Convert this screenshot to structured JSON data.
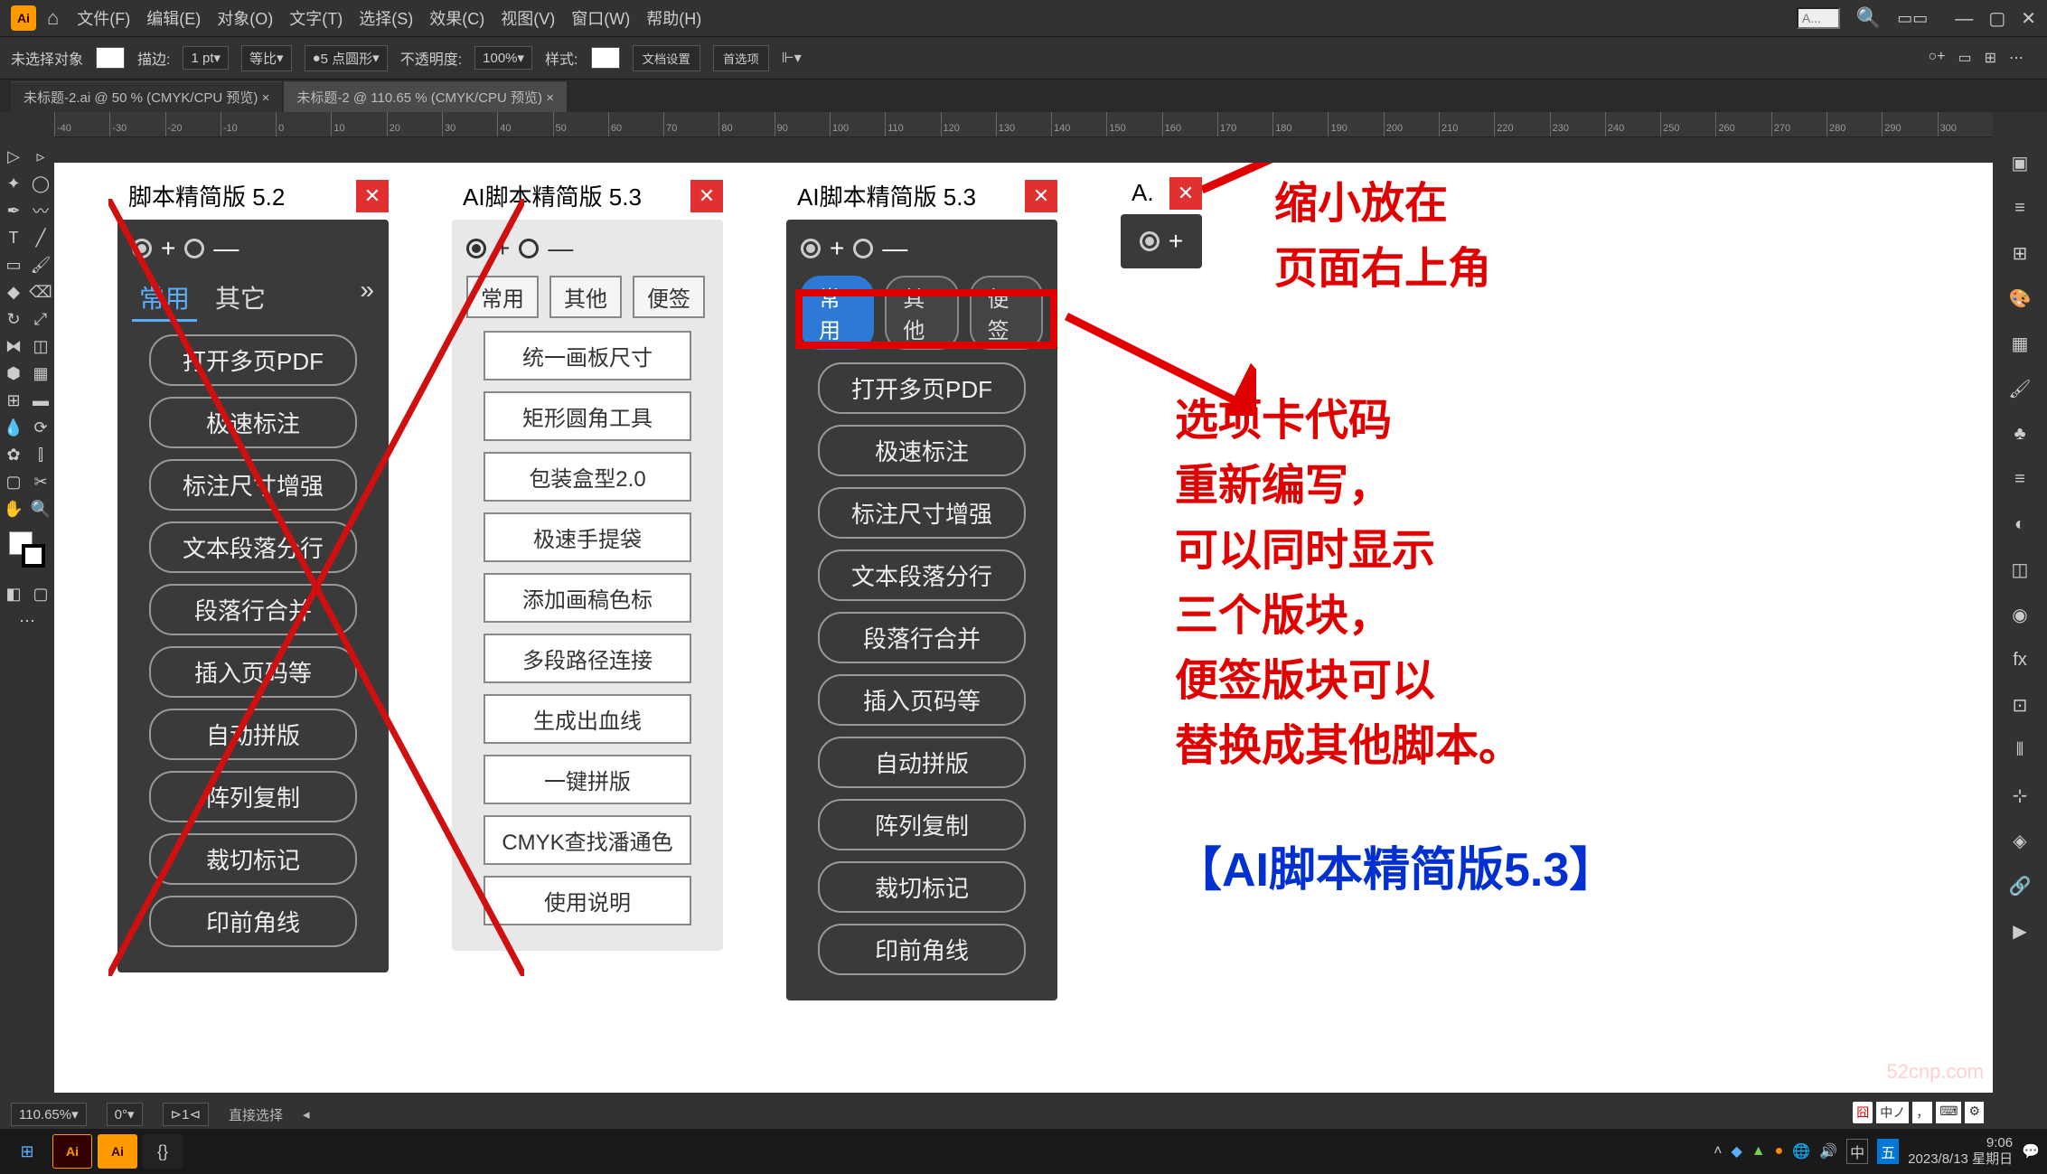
{
  "menu": {
    "items": [
      "文件(F)",
      "编辑(E)",
      "对象(O)",
      "文字(T)",
      "选择(S)",
      "效果(C)",
      "视图(V)",
      "窗口(W)",
      "帮助(H)"
    ],
    "topInputPlaceholder": "A..."
  },
  "optionsBar": {
    "noSelection": "未选择对象",
    "stroke": "描边:",
    "strokeVal": "1 pt",
    "uniform": "等比",
    "brushVal": "5 点圆形",
    "opacity": "不透明度:",
    "opacityVal": "100%",
    "style": "样式:",
    "docSetup": "文档设置",
    "prefs": "首选项"
  },
  "tabs": {
    "tab1": "未标题-2.ai @ 50 % (CMYK/CPU 预览)",
    "tab2": "未标题-2 @ 110.65 % (CMYK/CPU 预览)"
  },
  "ruler": [
    "-40",
    "-30",
    "-20",
    "-10",
    "0",
    "10",
    "20",
    "30",
    "40",
    "50",
    "60",
    "70",
    "80",
    "90",
    "100",
    "110",
    "120",
    "130",
    "140",
    "150",
    "160",
    "170",
    "180",
    "190",
    "200",
    "210",
    "220",
    "230",
    "240",
    "250",
    "260",
    "270",
    "280",
    "290",
    "300"
  ],
  "panel52": {
    "title": "脚本精简版 5.2",
    "tabs": [
      "常用",
      "其它"
    ],
    "buttons": [
      "打开多页PDF",
      "极速标注",
      "标注尺寸增强",
      "文本段落分行",
      "段落行合并",
      "插入页码等",
      "自动拼版",
      "阵列复制",
      "裁切标记",
      "印前角线"
    ]
  },
  "panel53light": {
    "title": "AI脚本精简版 5.3",
    "tabs": [
      "常用",
      "其他",
      "便签"
    ],
    "buttons": [
      "统一画板尺寸",
      "矩形圆角工具",
      "包装盒型2.0",
      "极速手提袋",
      "添加画稿色标",
      "多段路径连接",
      "生成出血线",
      "一键拼版",
      "CMYK查找潘通色",
      "使用说明"
    ]
  },
  "panel53dark": {
    "title": "AI脚本精简版 5.3",
    "tabs": [
      "常用",
      "其他",
      "便签"
    ],
    "buttons": [
      "打开多页PDF",
      "极速标注",
      "标注尺寸增强",
      "文本段落分行",
      "段落行合并",
      "插入页码等",
      "自动拼版",
      "阵列复制",
      "裁切标记",
      "印前角线"
    ]
  },
  "miniPanel": {
    "title": "A."
  },
  "annotations": {
    "line1": "缩小放在",
    "line2": "页面右上角",
    "block2": "选项卡代码\n重新编写，\n可以同时显示\n三个版块，\n便签版块可以\n替换成其他脚本。",
    "blue": "【AI脚本精简版5.3】"
  },
  "statusBar": {
    "zoom": "110.65%",
    "rotate": "0°",
    "coords": "1",
    "tool": "直接选择"
  },
  "taskbar": {
    "time": "9:06",
    "date": "2023/8/13 星期日"
  },
  "watermark": "52cnp.com"
}
